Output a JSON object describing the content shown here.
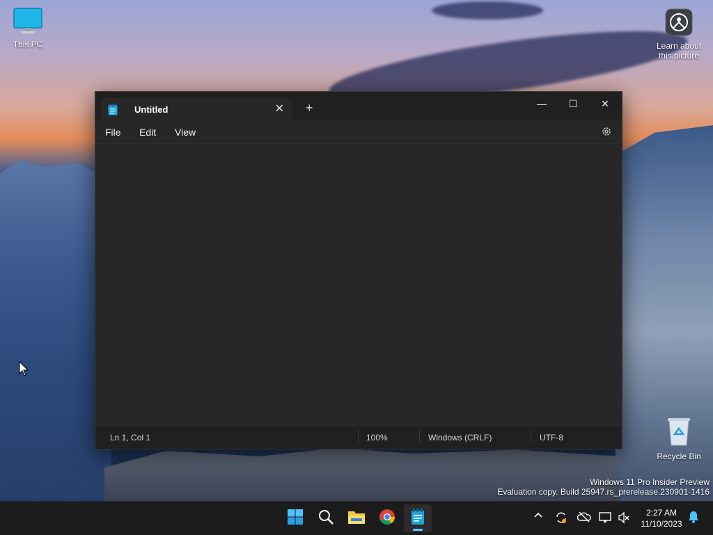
{
  "desktop": {
    "icons": [
      {
        "label": "This PC"
      },
      {
        "label": "Learn about this picture"
      },
      {
        "label": "Recycle Bin"
      }
    ],
    "watermark": {
      "line1": "Windows 11 Pro Insider Preview",
      "line2": "Evaluation copy. Build 25947.rs_prerelease.230901-1416"
    }
  },
  "notepad": {
    "tab_title": "Untitled",
    "close_tab_glyph": "✕",
    "new_tab_glyph": "+",
    "window_controls": {
      "minimize": "—",
      "maximize": "☐",
      "close": "✕"
    },
    "menu": [
      "File",
      "Edit",
      "View"
    ],
    "editor_text": "",
    "status": {
      "position": "Ln 1, Col 1",
      "zoom": "100%",
      "line_endings": "Windows (CRLF)",
      "encoding": "UTF-8"
    }
  },
  "taskbar": {
    "apps": [
      "start-icon",
      "search-icon",
      "file-explorer-icon",
      "chrome-icon",
      "notepad-icon"
    ],
    "active_app": "notepad-icon",
    "tray_icons": [
      "chevron-up-icon",
      "sync-icon",
      "onedrive-icon",
      "network-icon",
      "volume-muted-icon",
      "notification-bell-icon"
    ],
    "clock": {
      "time": "2:27 AM",
      "date": "11/10/2023"
    }
  },
  "colors": {
    "accent": "#60cdff",
    "window_bg": "#202020",
    "editor_bg": "#272727",
    "taskbar_bg": "#1c1c1c"
  }
}
